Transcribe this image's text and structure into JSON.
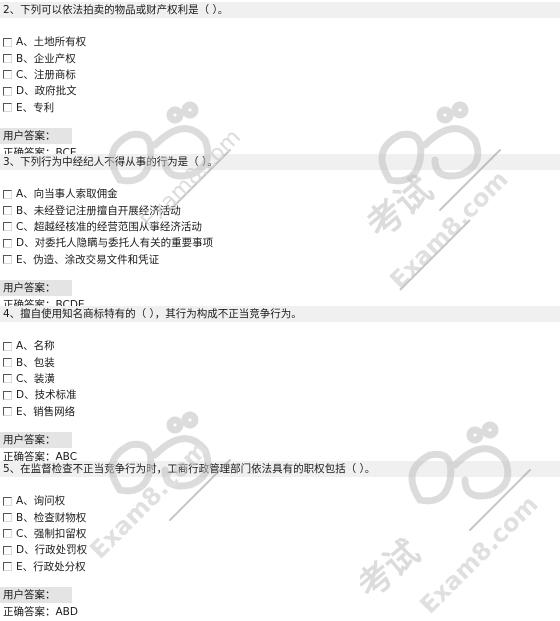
{
  "labels": {
    "user_answer": "用户答案：",
    "correct_answer_prefix": "正确答案："
  },
  "watermark": {
    "text_cn": "考试",
    "text_en": "Exam8.com",
    "color": "#c8c8c8"
  },
  "questions": [
    {
      "title": "2、下列可以依法拍卖的物品或财产权利是（  ）。",
      "options": [
        "A、土地所有权",
        "B、企业产权",
        "C、注册商标",
        "D、政府批文",
        "E、专利"
      ],
      "user_answer": "",
      "correct_answer": "正确答案：BCE"
    },
    {
      "title": "3、下列行为中经纪人不得从事的行为是（  ）。",
      "options": [
        "A、向当事人索取佣金",
        "B、未经登记注册擅自开展经济活动",
        "C、超越经核准的经营范围从事经济活动",
        "D、对委托人隐瞒与委托人有关的重要事项",
        "E、伪造、涂改交易文件和凭证"
      ],
      "user_answer": "",
      "correct_answer": "正确答案：BCDE"
    },
    {
      "title": "4、擅自使用知名商标特有的（  ），其行为构成不正当竞争行为。",
      "options": [
        "A、名称",
        "B、包装",
        "C、装潢",
        "D、技术标准",
        "E、销售网络"
      ],
      "user_answer": "",
      "correct_answer": "正确答案：ABC"
    },
    {
      "title": "5、在监督检查不正当竞争行为时，工商行政管理部门依法具有的职权包括（  ）。",
      "options": [
        "A、询问权",
        "B、检查财物权",
        "C、强制扣留权",
        "D、行政处罚权",
        "E、行政处分权"
      ],
      "user_answer": "",
      "correct_answer": "正确答案：ABD"
    }
  ]
}
